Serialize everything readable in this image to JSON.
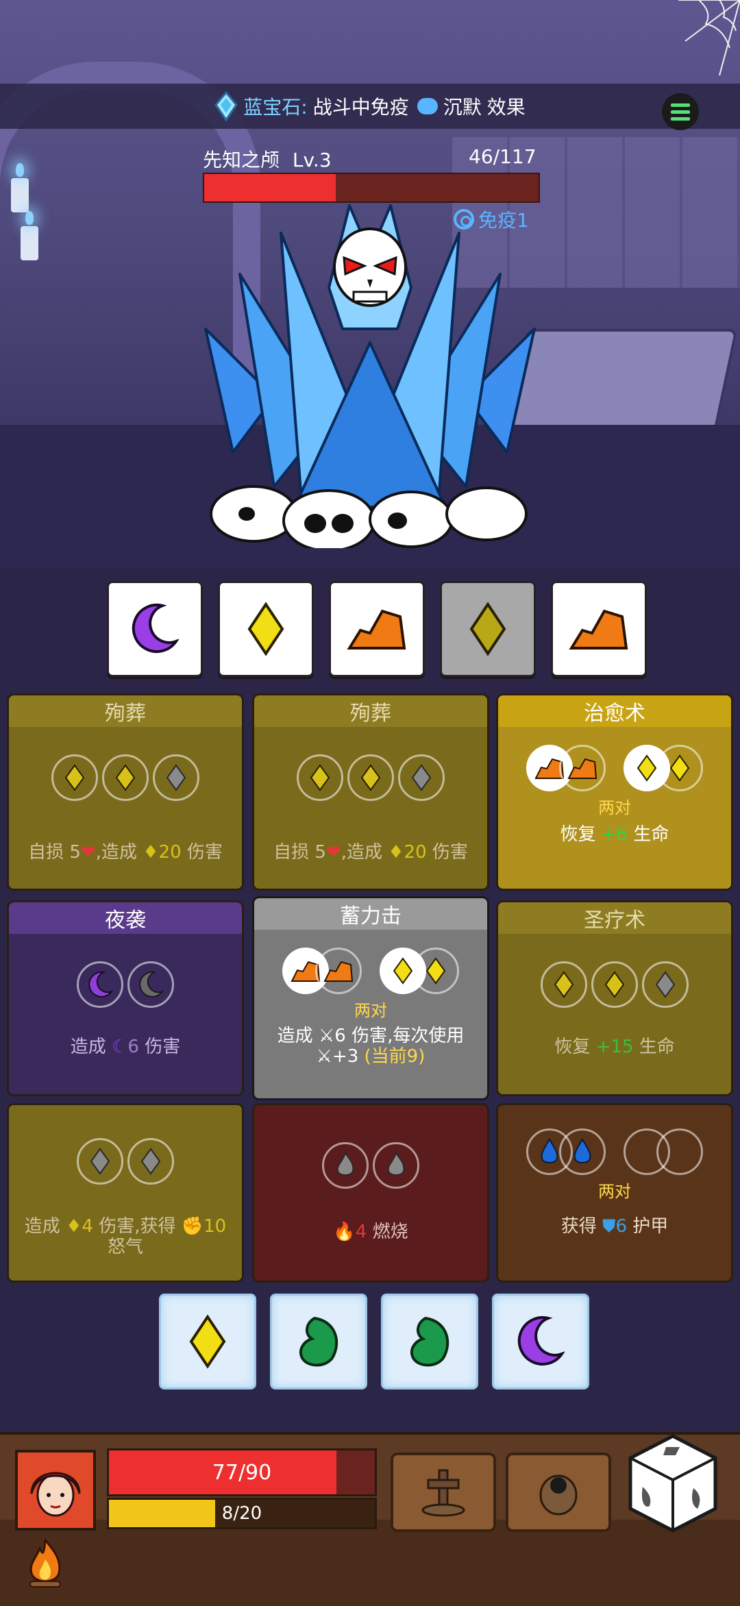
{
  "banner": {
    "gem_label": "蓝宝石:",
    "text_a": "战斗中免疫",
    "text_b": "沉默",
    "text_c": "效果"
  },
  "enemy": {
    "name": "先知之颅",
    "level": "Lv.3",
    "hp_text": "46/117",
    "hp_current": 46,
    "hp_max": 117,
    "status_immune": "免疫1"
  },
  "enemy_dice": [
    {
      "face": "moon",
      "used": false
    },
    {
      "face": "diamond",
      "used": false
    },
    {
      "face": "rock",
      "used": false
    },
    {
      "face": "diamond",
      "used": true
    },
    {
      "face": "rock",
      "used": false
    }
  ],
  "cards": {
    "c1": {
      "title": "殉葬",
      "desc_a": "自损 5",
      "desc_b": ",造成",
      "desc_c": "20",
      "desc_d": "伤害"
    },
    "c2": {
      "title": "殉葬",
      "desc_a": "自损 5",
      "desc_b": ",造成",
      "desc_c": "20",
      "desc_d": "伤害"
    },
    "c3": {
      "title": "治愈术",
      "pair": "两对",
      "desc_a": "恢复",
      "desc_b": "+6",
      "desc_c": "生命"
    },
    "c4": {
      "title": "夜袭",
      "desc_a": "造成",
      "desc_b": "6",
      "desc_c": "伤害"
    },
    "c5": {
      "title": "蓄力击",
      "pair": "两对",
      "desc_line1": "造成",
      "desc_num": "6",
      "desc_rest": "伤害,每次使用",
      "desc_line2": "+3",
      "desc_current": "(当前9)"
    },
    "c6": {
      "title": "圣疗术",
      "desc_a": "恢复",
      "desc_b": "+15",
      "desc_c": "生命"
    },
    "c7": {
      "desc_a": "造成",
      "desc_b": "4",
      "desc_c": "伤害,获得",
      "desc_d": "10",
      "desc_e": "怒气"
    },
    "c8": {
      "desc_a": "4",
      "desc_b": "燃烧"
    },
    "c9": {
      "pair": "两对",
      "desc_a": "获得",
      "desc_b": "6",
      "desc_c": "护甲"
    }
  },
  "hand_dice": [
    {
      "face": "diamond"
    },
    {
      "face": "leaf"
    },
    {
      "face": "leaf"
    },
    {
      "face": "moon"
    }
  ],
  "player": {
    "hp_text": "77/90",
    "hp_current": 77,
    "hp_max": 90,
    "rage_text": "8/20",
    "rage_current": 8,
    "rage_max": 20
  },
  "colors": {
    "accent_blue": "#58b5ff",
    "hp_red": "#ee2f2f",
    "rage_yellow": "#f2c51a",
    "pair_gold": "#ffd84a"
  }
}
